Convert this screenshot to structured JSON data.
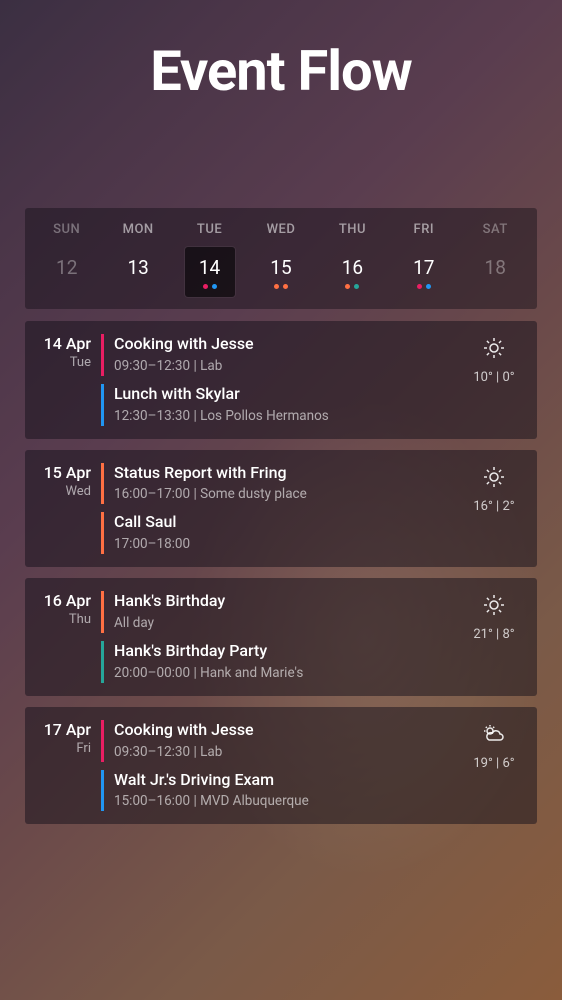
{
  "title": "Event Flow",
  "colors": {
    "pink": "#e91e63",
    "blue": "#2196f3",
    "orange": "#ff7043",
    "green": "#26a69a"
  },
  "week": [
    {
      "abbr": "SUN",
      "num": "12",
      "muted": true,
      "selected": false,
      "dots": []
    },
    {
      "abbr": "MON",
      "num": "13",
      "muted": false,
      "selected": false,
      "dots": []
    },
    {
      "abbr": "TUE",
      "num": "14",
      "muted": false,
      "selected": true,
      "dots": [
        "pink",
        "blue"
      ]
    },
    {
      "abbr": "WED",
      "num": "15",
      "muted": false,
      "selected": false,
      "dots": [
        "orange",
        "orange"
      ]
    },
    {
      "abbr": "THU",
      "num": "16",
      "muted": false,
      "selected": false,
      "dots": [
        "orange",
        "green"
      ]
    },
    {
      "abbr": "FRI",
      "num": "17",
      "muted": false,
      "selected": false,
      "dots": [
        "pink",
        "blue"
      ]
    },
    {
      "abbr": "SAT",
      "num": "18",
      "muted": true,
      "selected": false,
      "dots": []
    }
  ],
  "days": [
    {
      "date": "14 Apr",
      "dow": "Tue",
      "weather": {
        "icon": "sun",
        "temp": "10° | 0°"
      },
      "events": [
        {
          "color": "pink",
          "title": "Cooking with Jesse",
          "meta": "09:30–12:30  |  Lab"
        },
        {
          "color": "blue",
          "title": "Lunch with Skylar",
          "meta": "12:30–13:30  |  Los Pollos Hermanos"
        }
      ]
    },
    {
      "date": "15 Apr",
      "dow": "Wed",
      "weather": {
        "icon": "sun",
        "temp": "16° | 2°"
      },
      "events": [
        {
          "color": "orange",
          "title": "Status Report with Fring",
          "meta": "16:00–17:00  |  Some dusty place"
        },
        {
          "color": "orange",
          "title": "Call Saul",
          "meta": "17:00–18:00"
        }
      ]
    },
    {
      "date": "16 Apr",
      "dow": "Thu",
      "weather": {
        "icon": "sun",
        "temp": "21° | 8°"
      },
      "events": [
        {
          "color": "orange",
          "title": "Hank's Birthday",
          "meta": "All day"
        },
        {
          "color": "green",
          "title": "Hank's Birthday Party",
          "meta": "20:00–00:00  |  Hank and Marie's"
        }
      ]
    },
    {
      "date": "17 Apr",
      "dow": "Fri",
      "weather": {
        "icon": "sun-cloud",
        "temp": "19° | 6°"
      },
      "events": [
        {
          "color": "pink",
          "title": "Cooking with Jesse",
          "meta": "09:30–12:30  |  Lab"
        },
        {
          "color": "blue",
          "title": "Walt Jr.'s Driving Exam",
          "meta": "15:00–16:00  |  MVD Albuquerque"
        }
      ]
    }
  ]
}
